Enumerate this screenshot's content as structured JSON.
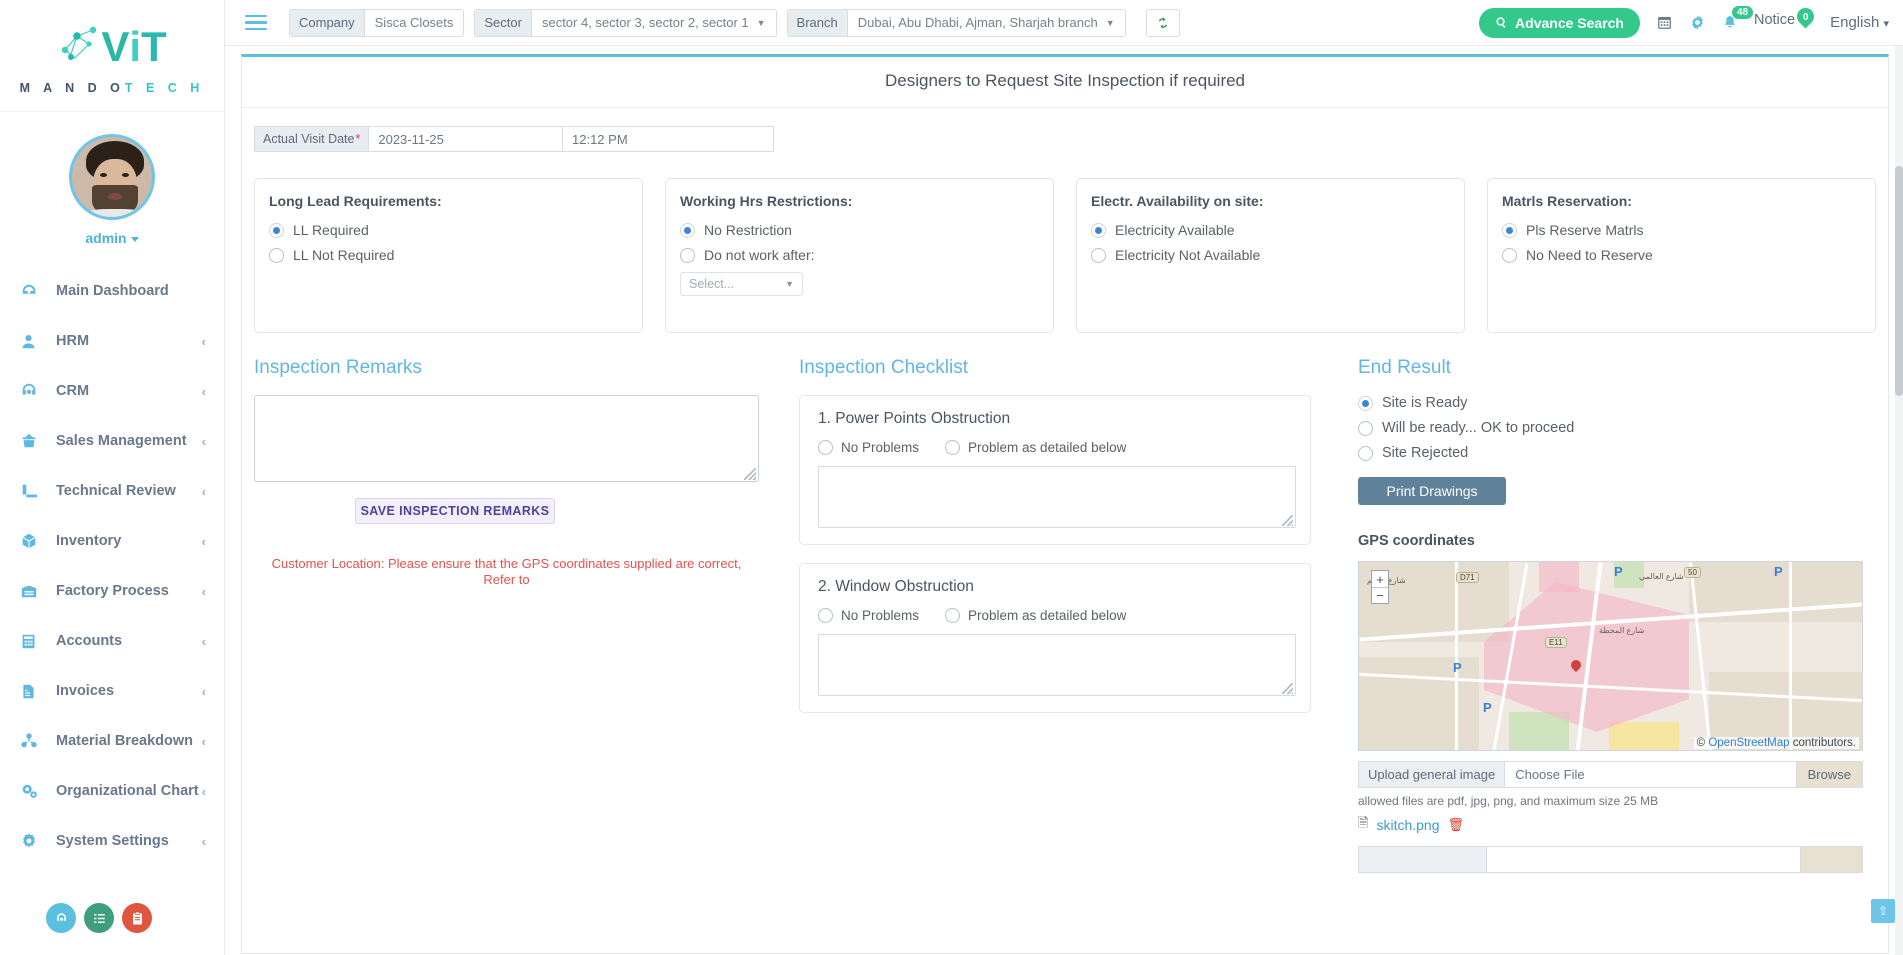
{
  "brand": {
    "logo_v": "V",
    "logo_i": "i",
    "logo_t": "T",
    "wordmark_dark": "M A N D O",
    "wordmark_teal": "T E C H",
    "accent": "#5bc0de",
    "green": "#32c98a"
  },
  "sidebar": {
    "user": {
      "name": "admin",
      "avatar": "user-avatar"
    },
    "items": [
      {
        "label": "Main Dashboard",
        "icon": "dashboard-icon",
        "has_chevron": false
      },
      {
        "label": "HRM",
        "icon": "user-icon",
        "has_chevron": true
      },
      {
        "label": "CRM",
        "icon": "headset-icon",
        "has_chevron": true
      },
      {
        "label": "Sales Management",
        "icon": "basket-icon",
        "has_chevron": true
      },
      {
        "label": "Technical Review",
        "icon": "ruler-icon",
        "has_chevron": true
      },
      {
        "label": "Inventory",
        "icon": "box-icon",
        "has_chevron": true
      },
      {
        "label": "Factory Process",
        "icon": "factory-icon",
        "has_chevron": true
      },
      {
        "label": "Accounts",
        "icon": "calculator-icon",
        "has_chevron": true
      },
      {
        "label": "Invoices",
        "icon": "invoice-icon",
        "has_chevron": true
      },
      {
        "label": "Material Breakdown",
        "icon": "molecule-icon",
        "has_chevron": true
      },
      {
        "label": "Organizational Chart",
        "icon": "gears-icon",
        "has_chevron": true
      },
      {
        "label": "System Settings",
        "icon": "settings-icon",
        "has_chevron": true
      }
    ],
    "fabs": [
      {
        "name": "support-fab",
        "glyph": "☎",
        "color": "#5bc0de"
      },
      {
        "name": "tasks-fab",
        "glyph": "☰",
        "color": "#3f9e7d"
      },
      {
        "name": "clipboard-fab",
        "glyph": "☷",
        "color": "#e0553f"
      }
    ]
  },
  "topbar": {
    "menu_toggle": "hamburger-icon",
    "company": {
      "label": "Company",
      "value": "Sisca Closets"
    },
    "sector": {
      "label": "Sector",
      "value": "sector 4, sector 3, sector 2, sector 1"
    },
    "branch": {
      "label": "Branch",
      "value": "Dubai, Abu Dhabi, Ajman, Sharjah branch"
    },
    "refresh": "refresh-icon",
    "advance_search": "Advance Search",
    "calendar_icon": "calendar-icon",
    "gear_icon": "gear-icon",
    "bell_icon": "bell-icon",
    "bell_count": "48",
    "notice_label": "Notice",
    "notice_count": "0",
    "language": "English"
  },
  "content": {
    "header_title": "Designers to Request Site Inspection if required",
    "visit": {
      "label": "Actual Visit Date",
      "required_mark": "*",
      "date": "2023-11-25",
      "time": "12:12 PM"
    },
    "cards": [
      {
        "title": "Long Lead Requirements:",
        "options": [
          {
            "label": "LL Required",
            "selected": true
          },
          {
            "label": "LL Not Required",
            "selected": false
          }
        ]
      },
      {
        "title": "Working Hrs Restrictions:",
        "options": [
          {
            "label": "No Restriction",
            "selected": true
          },
          {
            "label": "Do not work after:",
            "selected": false
          }
        ],
        "select_placeholder": "Select..."
      },
      {
        "title": "Electr. Availability on site:",
        "options": [
          {
            "label": "Electricity Available",
            "selected": true
          },
          {
            "label": "Electricity Not Available",
            "selected": false
          }
        ]
      },
      {
        "title": "Matrls Reservation:",
        "options": [
          {
            "label": "Pls Reserve Matrls",
            "selected": true
          },
          {
            "label": "No Need to Reserve",
            "selected": false
          }
        ]
      }
    ],
    "remarks": {
      "title": "Inspection Remarks",
      "textarea_value": "",
      "save_button": "SAVE INSPECTION REMARKS",
      "warning": "Customer Location: Please ensure that the GPS coordinates supplied are correct, Refer to"
    },
    "checklist": {
      "title": "Inspection Checklist",
      "items": [
        {
          "title": "1. Power Points Obstruction",
          "opt_ok": "No Problems",
          "opt_problem": "Problem as detailed below",
          "ok_selected": false,
          "problem_selected": false,
          "detail_value": ""
        },
        {
          "title": "2. Window Obstruction",
          "opt_ok": "No Problems",
          "opt_problem": "Problem as detailed below",
          "ok_selected": false,
          "problem_selected": false,
          "detail_value": ""
        }
      ]
    },
    "end_result": {
      "title": "End Result",
      "options": [
        {
          "label": "Site is Ready",
          "selected": true
        },
        {
          "label": "Will be ready... OK to proceed",
          "selected": false
        },
        {
          "label": "Site Rejected",
          "selected": false
        }
      ],
      "print_button": "Print Drawings",
      "gps_title": "GPS coordinates",
      "map": {
        "zoom_in": "+",
        "zoom_out": "−",
        "attribution_prefix": "© ",
        "attribution_link": "OpenStreetMap",
        "attribution_suffix": " contributors.",
        "road_labels": [
          "D71",
          "E11",
          "50"
        ],
        "parking_marks": [
          "P",
          "P",
          "P",
          "P"
        ]
      },
      "upload": {
        "label": "Upload general image",
        "file_placeholder": "Choose File",
        "browse": "Browse",
        "allowed": "allowed files are pdf, jpg, png, and maximum size 25 MB",
        "uploaded_file": "skitch.png",
        "delete_icon": "trash-icon"
      }
    },
    "scroll_top": "scroll-to-top-icon"
  }
}
